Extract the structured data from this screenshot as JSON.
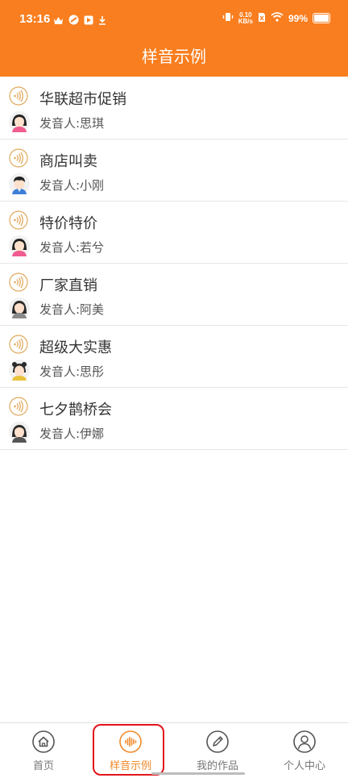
{
  "status_bar": {
    "time": "13:16",
    "net_speed_value": "0.10",
    "net_speed_unit": "KB/s",
    "battery": "99%"
  },
  "header": {
    "title": "样音示例"
  },
  "samples": [
    {
      "title": "华联超市促销",
      "speaker": "发音人:思琪"
    },
    {
      "title": "商店叫卖",
      "speaker": "发音人:小刚"
    },
    {
      "title": "特价特价",
      "speaker": "发音人:若兮"
    },
    {
      "title": "厂家直销",
      "speaker": "发音人:阿美"
    },
    {
      "title": "超级大实惠",
      "speaker": "发音人:思彤"
    },
    {
      "title": "七夕鹊桥会",
      "speaker": "发音人:伊娜"
    }
  ],
  "tabs": [
    {
      "label": "首页",
      "icon": "home-icon"
    },
    {
      "label": "样音示例",
      "icon": "sound-wave-icon"
    },
    {
      "label": "我的作品",
      "icon": "pencil-icon"
    },
    {
      "label": "个人中心",
      "icon": "user-icon"
    }
  ],
  "colors": {
    "brand": "#f97e1f",
    "active_tab": "#f08a2c",
    "highlight": "#e3141b"
  }
}
